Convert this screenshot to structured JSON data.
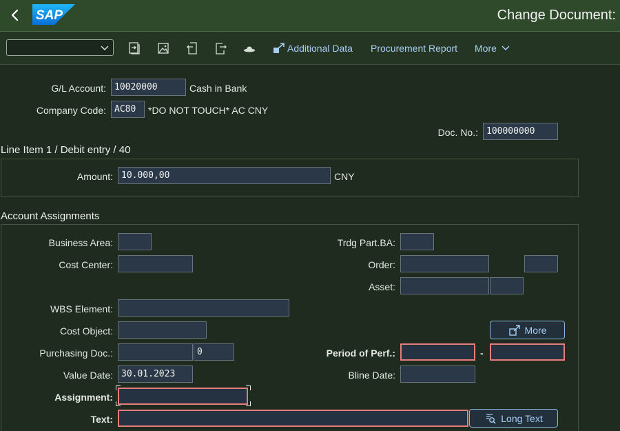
{
  "header": {
    "logo_text": "SAP",
    "title": "Change Document:",
    "back_icon": "chevron-left-icon"
  },
  "toolbar": {
    "layout_select_value": "",
    "icons": [
      "document-switch-icon",
      "image-icon",
      "document-return-icon",
      "document-forward-icon",
      "hat-icon"
    ],
    "additional_data": "Additional Data",
    "procurement_report": "Procurement Report",
    "more": "More"
  },
  "document": {
    "gl_account_label": "G/L Account:",
    "gl_account_value": "10020000",
    "gl_account_text": "Cash in Bank",
    "company_code_label": "Company Code:",
    "company_code_value": "AC80",
    "company_code_text": "*DO NOT TOUCH* AC CNY",
    "doc_no_label": "Doc. No.:",
    "doc_no_value": "100000000"
  },
  "line_item": {
    "title": "Line Item 1 / Debit entry / 40",
    "amount_label": "Amount:",
    "amount_value": "10.000,00",
    "currency": "CNY"
  },
  "assignments": {
    "title": "Account Assignments",
    "business_area_label": "Business Area:",
    "business_area_value": "",
    "trdg_part_label": "Trdg Part.BA:",
    "trdg_part_value": "",
    "cost_center_label": "Cost Center:",
    "cost_center_value": "",
    "order_label": "Order:",
    "order_value": "",
    "order_value2": "",
    "asset_label": "Asset:",
    "asset_value": "",
    "asset_value2": "",
    "wbs_label": "WBS Element:",
    "wbs_value": "",
    "cost_object_label": "Cost Object:",
    "cost_object_value": "",
    "more_button": "More",
    "purchasing_doc_label": "Purchasing Doc.:",
    "purchasing_doc_value": "",
    "purchasing_doc_item": "0",
    "period_label": "Period of Perf.:",
    "period_from": "",
    "period_sep": "-",
    "period_to": "",
    "value_date_label": "Value Date:",
    "value_date_value": "30.01.2023",
    "bline_date_label": "Bline Date:",
    "bline_date_value": "",
    "assignment_label": "Assignment:",
    "assignment_value": "",
    "text_label": "Text:",
    "text_value": "",
    "long_text_button": "Long Text"
  },
  "colors": {
    "shellbar": "#2f4a2a",
    "background": "#1f2b1f",
    "link": "#a8cdf5",
    "required_border": "#e67d7d"
  }
}
